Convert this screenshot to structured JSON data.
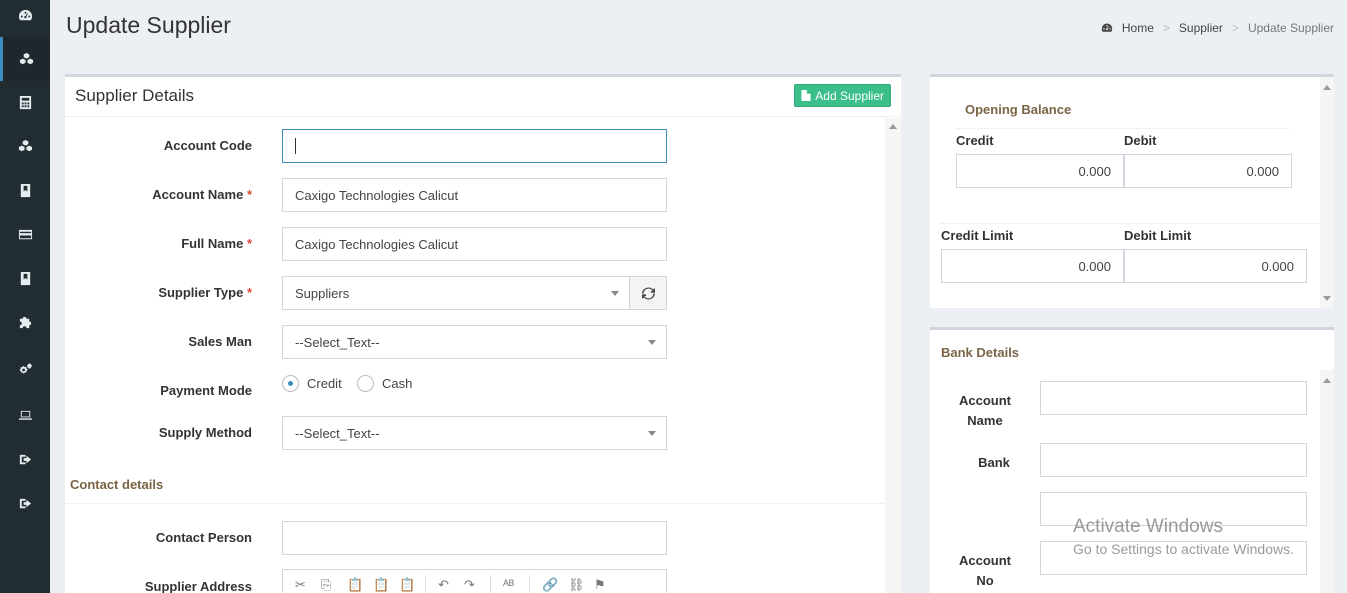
{
  "sidebar": {
    "items": [
      {
        "icon": "dashboard-icon"
      },
      {
        "icon": "cubes-icon",
        "active": true
      },
      {
        "icon": "calculator-icon"
      },
      {
        "icon": "cubes-icon"
      },
      {
        "icon": "book-icon"
      },
      {
        "icon": "credit-card-icon"
      },
      {
        "icon": "book-icon"
      },
      {
        "icon": "puzzle-icon"
      },
      {
        "icon": "cogs-icon"
      },
      {
        "icon": "laptop-icon"
      },
      {
        "icon": "sign-out-icon"
      },
      {
        "icon": "sign-out-icon"
      }
    ]
  },
  "header": {
    "title": "Update Supplier",
    "breadcrumb": [
      "Home",
      "Supplier",
      "Update Supplier"
    ],
    "separator": ">"
  },
  "main": {
    "box_title": "Supplier Details",
    "add_button": "Add Supplier",
    "fields": {
      "account_code": {
        "label": "Account Code",
        "value": ""
      },
      "account_name": {
        "label": "Account Name",
        "value": "Caxigo Technologies Calicut",
        "required": "*"
      },
      "full_name": {
        "label": "Full Name",
        "value": "Caxigo Technologies Calicut",
        "required": "*"
      },
      "supplier_type": {
        "label": "Supplier Type",
        "value": "Suppliers",
        "required": "*"
      },
      "sales_man": {
        "label": "Sales Man",
        "value": "--Select_Text--"
      },
      "payment_mode": {
        "label": "Payment Mode",
        "options": [
          "Credit",
          "Cash"
        ],
        "selected": "Credit"
      },
      "supply_method": {
        "label": "Supply Method",
        "value": "--Select_Text--"
      }
    },
    "contact_section": "Contact details",
    "contact_person": {
      "label": "Contact Person",
      "value": ""
    },
    "supplier_address": {
      "label": "Supplier Address"
    }
  },
  "opening_balance": {
    "title": "Opening Balance",
    "credit_label": "Credit",
    "debit_label": "Debit",
    "credit_value": "0.000",
    "debit_value": "0.000",
    "credit_limit_label": "Credit Limit",
    "debit_limit_label": "Debit Limit",
    "credit_limit_value": "0.000",
    "debit_limit_value": "0.000"
  },
  "bank_details": {
    "title": "Bank Details",
    "account_name_label": "Account Name",
    "bank_label": "Bank",
    "account_no_label": "Account No"
  },
  "watermark": {
    "line1": "Activate Windows",
    "line2": "Go to Settings to activate Windows."
  },
  "colors": {
    "sidebar_bg": "#222d32",
    "accent": "#3c8dbc",
    "add_button": "#3bbf8a",
    "section_title": "#7a6445",
    "required": "#dd4b39"
  }
}
